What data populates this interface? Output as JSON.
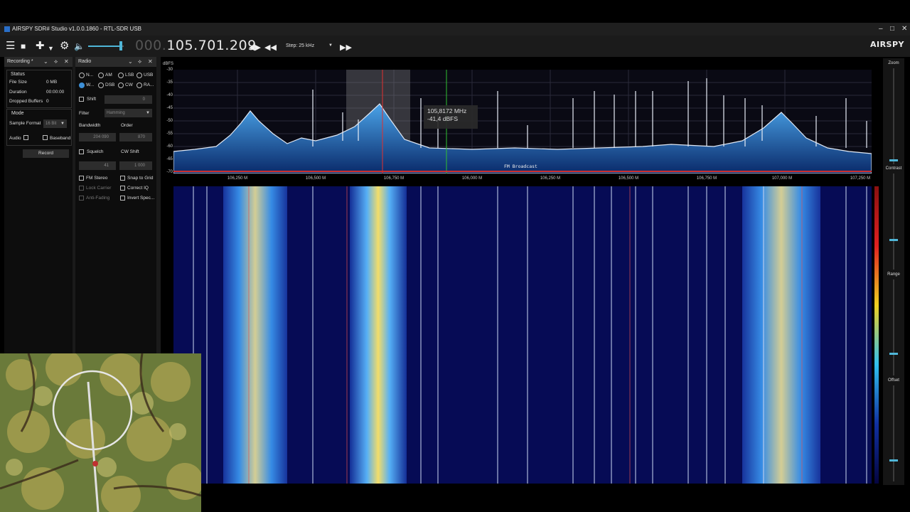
{
  "window": {
    "title": "AIRSPY SDR# Studio v1.0.0.1860 - RTL-SDR USB",
    "minimize_icon": "minimize-icon",
    "maximize_icon": "maximize-icon",
    "close_icon": "close-icon"
  },
  "toolbar": {
    "freq_prefix": "000.",
    "freq_main": "105.701.209",
    "step_label": "Step: 25 kHz",
    "brand": "AIRSPY"
  },
  "recording_panel": {
    "title": "Recording *",
    "status_header": "Status",
    "rows": [
      {
        "label": "File Size",
        "value": "0 MB"
      },
      {
        "label": "Duration",
        "value": "00:00:00"
      },
      {
        "label": "Dropped Buffers",
        "value": "0"
      }
    ],
    "mode_header": "Mode",
    "sample_format_label": "Sample Format",
    "sample_format_value": "16 Bit",
    "audio_label": "Audio",
    "baseband_label": "Baseband",
    "record_button": "Record"
  },
  "radio_panel": {
    "title": "Radio",
    "modes": [
      "N...",
      "AM",
      "LSB",
      "USB",
      "W...",
      "DSB",
      "CW",
      "RA..."
    ],
    "selected_mode": "W...",
    "shift_label": "Shift",
    "shift_value": "0",
    "filter_label": "Filter",
    "filter_value": "Hamming",
    "bandwidth_label": "Bandwidth",
    "order_label": "Order",
    "bandwidth_value": "204 090",
    "order_value": "870",
    "squelch_label": "Squelch",
    "cw_shift_label": "CW Shift",
    "squelch_value": "41",
    "cw_shift_value": "1 000",
    "fm_stereo_label": "FM Stereo",
    "snap_to_grid_label": "Snap to Grid",
    "lock_carrier_label": "Lock Carrier",
    "correct_iq_label": "Correct IQ",
    "anti_fading_label": "Anti-Fading",
    "invert_spectrum_label": "Invert Spec..."
  },
  "spectrum": {
    "unit_label": "dBFS",
    "y_ticks": [
      "-30",
      "-35",
      "-40",
      "-45",
      "-50",
      "-55",
      "-60",
      "-65",
      "-70"
    ],
    "x_ticks": [
      "106,250 M",
      "106,500 M",
      "106,750 M",
      "106,000 M",
      "106,250 M",
      "106,500 M",
      "106,750 M",
      "107,000 M",
      "107,250 M"
    ],
    "band_label": "FM Broadcast",
    "tooltip_freq": "105,8172 MHz",
    "tooltip_level": "-41,4 dBFS"
  },
  "right_controls": {
    "zoom_label": "Zoom",
    "contrast_label": "Contrast",
    "range_label": "Range",
    "offset_label": "Offset"
  },
  "colors": {
    "accent": "#3d8fd6",
    "spectrum_fill": "#1f6fb8",
    "waterfall_bg": "#05084a"
  }
}
